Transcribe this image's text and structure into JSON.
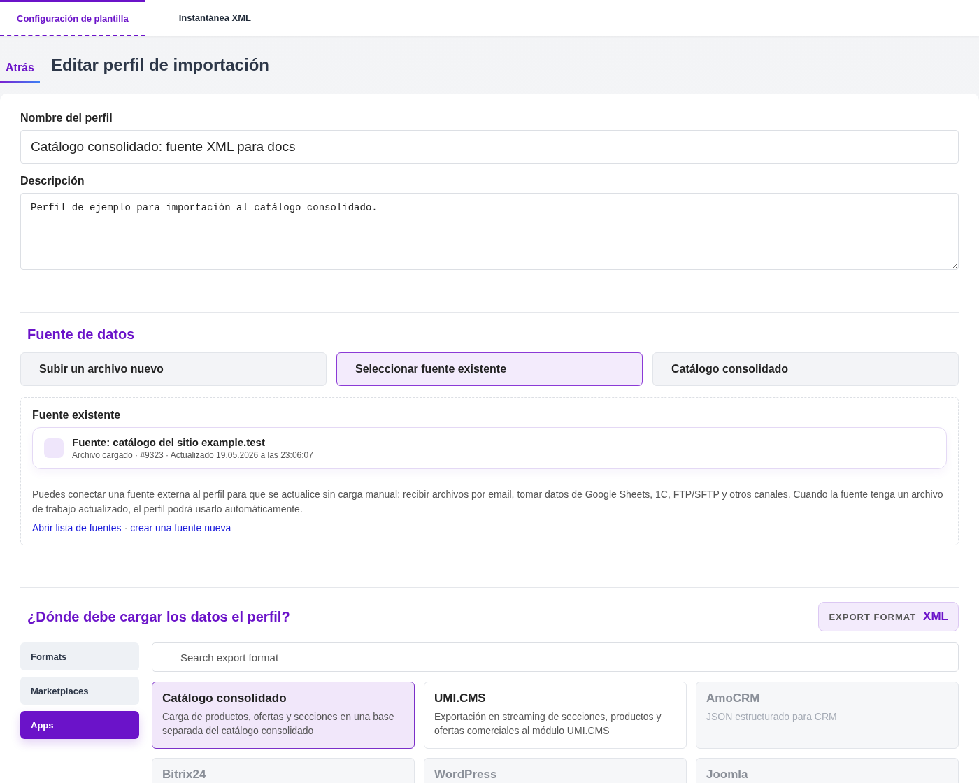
{
  "tabs": [
    {
      "label": "Configuración de plantilla",
      "selected": true
    },
    {
      "label": "Instantánea XML",
      "selected": false
    }
  ],
  "header": {
    "back_link": "Atrás",
    "title": "Editar perfil de importación"
  },
  "profile_name": {
    "label": "Nombre del perfil",
    "value": "Catálogo consolidado: fuente XML para docs"
  },
  "description": {
    "label": "Descripción",
    "value": "Perfil de ejemplo para importación al catálogo consolidado."
  },
  "data_source": {
    "heading": "Fuente de datos",
    "options": [
      {
        "label": "Subir un archivo nuevo",
        "selected": false
      },
      {
        "label": "Seleccionar fuente existente",
        "selected": true
      },
      {
        "label": "Catálogo consolidado",
        "selected": false
      }
    ],
    "existing": {
      "heading": "Fuente existente",
      "source_title": "Fuente: catálogo del sitio example.test",
      "source_meta": "Archivo cargado · #9323 · Actualizado 19.05.2026 a las 23:06:07",
      "note": "Puedes conectar una fuente externa al perfil para que se actualice sin carga manual: recibir archivos por email, tomar datos de Google Sheets, 1C, FTP/SFTP y otros canales. Cuando la fuente tenga un archivo de trabajo actualizado, el perfil podrá usarlo automáticamente.",
      "links": [
        "Abrir lista de fuentes",
        "crear una fuente nueva"
      ],
      "separator": "·"
    }
  },
  "export": {
    "heading": "¿Dónde debe cargar los datos el perfil?",
    "badge_label": "EXPORT FORMAT",
    "badge_value": "XML",
    "categories": [
      {
        "label": "Formats",
        "selected": false
      },
      {
        "label": "Marketplaces",
        "selected": false
      },
      {
        "label": "Apps",
        "selected": true
      }
    ],
    "search": {
      "placeholder": "Search export format"
    },
    "formats": [
      {
        "title": "Catálogo consolidado",
        "description": "Carga de productos, ofertas y secciones en una base separada del catálogo consolidado",
        "selected": true,
        "disabled": false
      },
      {
        "title": "UMI.CMS",
        "description": "Exportación en streaming de secciones, productos y ofertas comerciales al módulo UMI.CMS",
        "selected": false,
        "disabled": false
      },
      {
        "title": "AmoCRM",
        "description": "JSON estructurado para CRM",
        "selected": false,
        "disabled": true
      },
      {
        "title": "Bitrix24",
        "selected": false,
        "disabled": true
      },
      {
        "title": "WordPress",
        "selected": false,
        "disabled": true
      },
      {
        "title": "Joomla",
        "selected": false,
        "disabled": true
      }
    ]
  }
}
